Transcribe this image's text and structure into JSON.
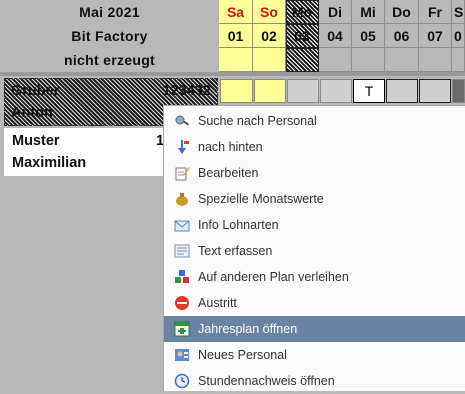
{
  "header": {
    "month": "Mai 2021",
    "company": "Bit Factory",
    "status": "nicht erzeugt"
  },
  "days": [
    {
      "name": "Sa",
      "num": "01"
    },
    {
      "name": "So",
      "num": "02"
    },
    {
      "name": "Mo",
      "num": "03"
    },
    {
      "name": "Di",
      "num": "04"
    },
    {
      "name": "Mi",
      "num": "05"
    },
    {
      "name": "Do",
      "num": "06"
    },
    {
      "name": "Fr",
      "num": "07"
    },
    {
      "name": "S",
      "num": "0"
    }
  ],
  "employees": [
    {
      "last": "Gruber",
      "first": "Anton",
      "id": "123432"
    },
    {
      "last": "Muster",
      "first": "Maximilian",
      "id": "1"
    }
  ],
  "row1_mark": "T",
  "menu": {
    "items": [
      {
        "label": "Suche nach Personal",
        "icon": "search-person-icon"
      },
      {
        "label": "nach hinten",
        "icon": "arrow-back-icon"
      },
      {
        "label": "Bearbeiten",
        "icon": "edit-icon"
      },
      {
        "label": "Spezielle Monatswerte",
        "icon": "money-bag-icon"
      },
      {
        "label": "Info Lohnarten",
        "icon": "mail-info-icon"
      },
      {
        "label": "Text erfassen",
        "icon": "text-icon"
      },
      {
        "label": "Auf anderen Plan verleihen",
        "icon": "lend-icon"
      },
      {
        "label": "Austritt",
        "icon": "stop-icon"
      },
      {
        "label": "Jahresplan öffnen",
        "icon": "year-plan-icon"
      },
      {
        "label": "Neues Personal",
        "icon": "new-person-icon"
      },
      {
        "label": "Stundennachweis öffnen",
        "icon": "clock-icon"
      }
    ],
    "selected_index": 8
  }
}
